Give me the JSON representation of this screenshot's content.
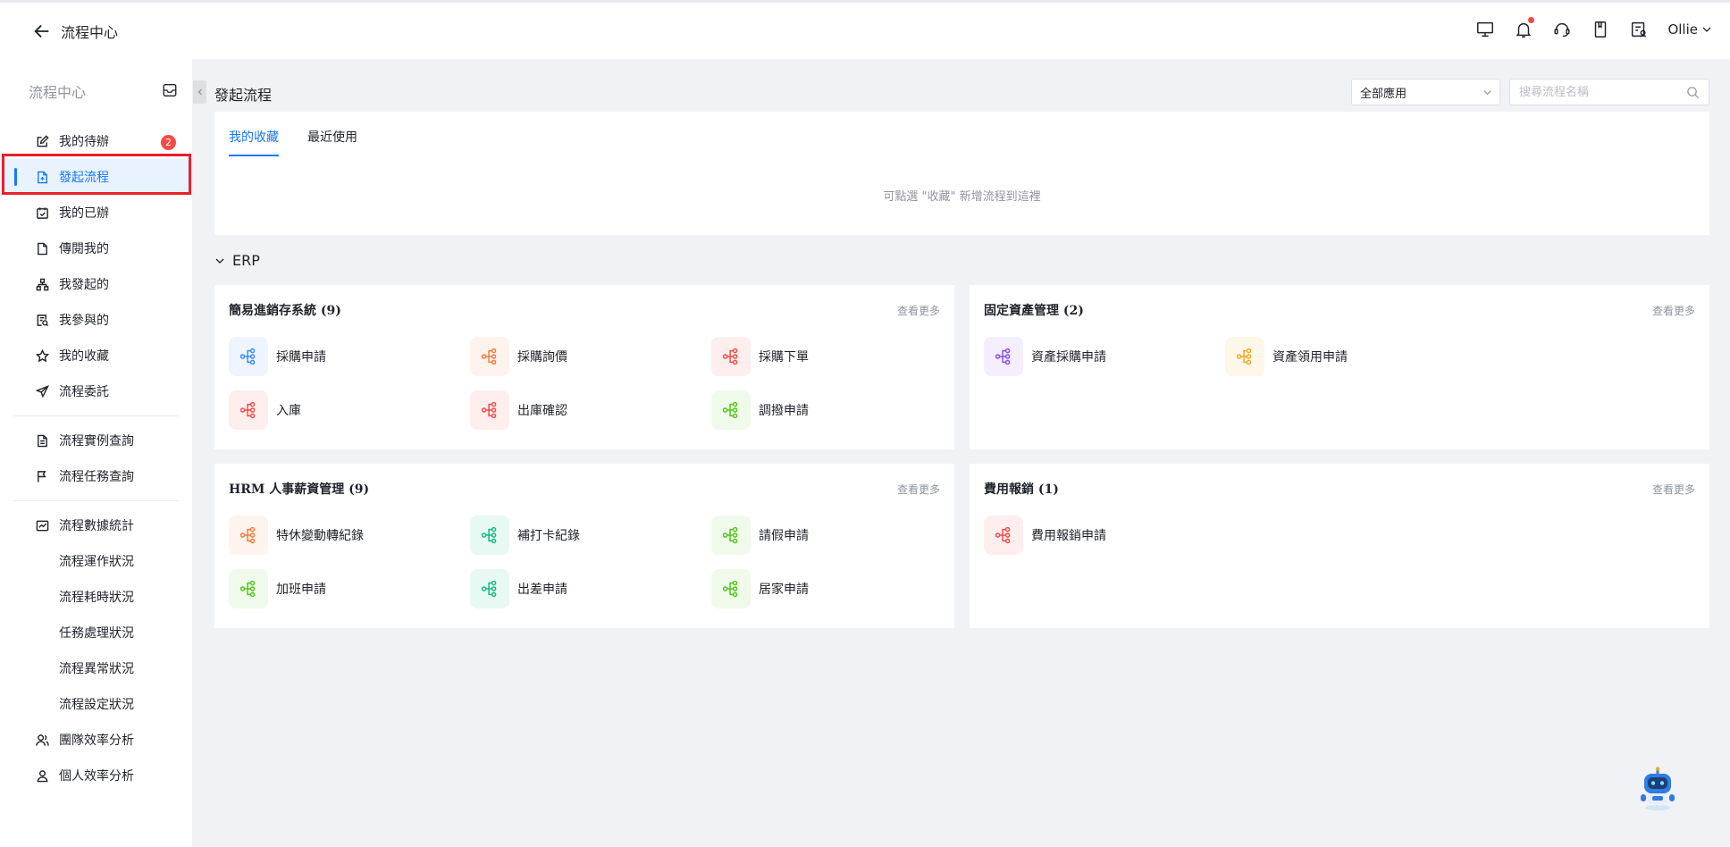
{
  "topbar": {
    "title": "流程中心",
    "user": "Ollie"
  },
  "sidebar": {
    "title": "流程中心",
    "todo_badge": "2",
    "items": [
      {
        "label": "我的待辦"
      },
      {
        "label": "發起流程"
      },
      {
        "label": "我的已辦"
      },
      {
        "label": "傳閱我的"
      },
      {
        "label": "我發起的"
      },
      {
        "label": "我參與的"
      },
      {
        "label": "我的收藏"
      },
      {
        "label": "流程委託"
      },
      {
        "label": "流程實例查詢"
      },
      {
        "label": "流程任務查詢"
      },
      {
        "label": "流程數據統計"
      },
      {
        "label": "流程運作狀況"
      },
      {
        "label": "流程耗時狀況"
      },
      {
        "label": "任務處理狀況"
      },
      {
        "label": "流程異常狀況"
      },
      {
        "label": "流程設定狀況"
      },
      {
        "label": "團隊效率分析"
      },
      {
        "label": "個人效率分析"
      }
    ]
  },
  "main": {
    "title": "發起流程",
    "app_select": "全部應用",
    "search_placeholder": "搜尋流程名稱",
    "tabs": [
      "我的收藏",
      "最近使用"
    ],
    "empty_text": "可點選 \"收藏\" 新增流程到這裡",
    "group": "ERP",
    "more_label": "查看更多",
    "cards": [
      {
        "title": "簡易進銷存系統 (9)",
        "processes": [
          {
            "label": "採購申請",
            "color": "#3d8bf2",
            "bg": "#eef5fe"
          },
          {
            "label": "採購詢價",
            "color": "#f57a3d",
            "bg": "#fef3ed"
          },
          {
            "label": "採購下單",
            "color": "#f54a45",
            "bg": "#feeeee"
          },
          {
            "label": "入庫",
            "color": "#f54a45",
            "bg": "#feeeee"
          },
          {
            "label": "出庫確認",
            "color": "#f54a45",
            "bg": "#feeeee"
          },
          {
            "label": "調撥申請",
            "color": "#52c41a",
            "bg": "#f0faeb"
          }
        ]
      },
      {
        "title": "固定資產管理 (2)",
        "processes": [
          {
            "label": "資產採購申請",
            "color": "#8a4de8",
            "bg": "#f4eefe"
          },
          {
            "label": "資產領用申請",
            "color": "#f5a623",
            "bg": "#fff7e8"
          }
        ]
      },
      {
        "title": "HRM 人事薪資管理 (9)",
        "processes": [
          {
            "label": "特休變動轉紀錄",
            "color": "#f57a3d",
            "bg": "#fef3ed"
          },
          {
            "label": "補打卡紀錄",
            "color": "#14b885",
            "bg": "#e8f8f2"
          },
          {
            "label": "請假申請",
            "color": "#52c41a",
            "bg": "#f0faeb"
          },
          {
            "label": "加班申請",
            "color": "#52c41a",
            "bg": "#f0faeb"
          },
          {
            "label": "出差申請",
            "color": "#14b885",
            "bg": "#e8f8f2"
          },
          {
            "label": "居家申請",
            "color": "#52c41a",
            "bg": "#f0faeb"
          }
        ]
      },
      {
        "title": "費用報銷 (1)",
        "processes": [
          {
            "label": "費用報銷申請",
            "color": "#f54a45",
            "bg": "#feeeee"
          }
        ]
      }
    ]
  }
}
